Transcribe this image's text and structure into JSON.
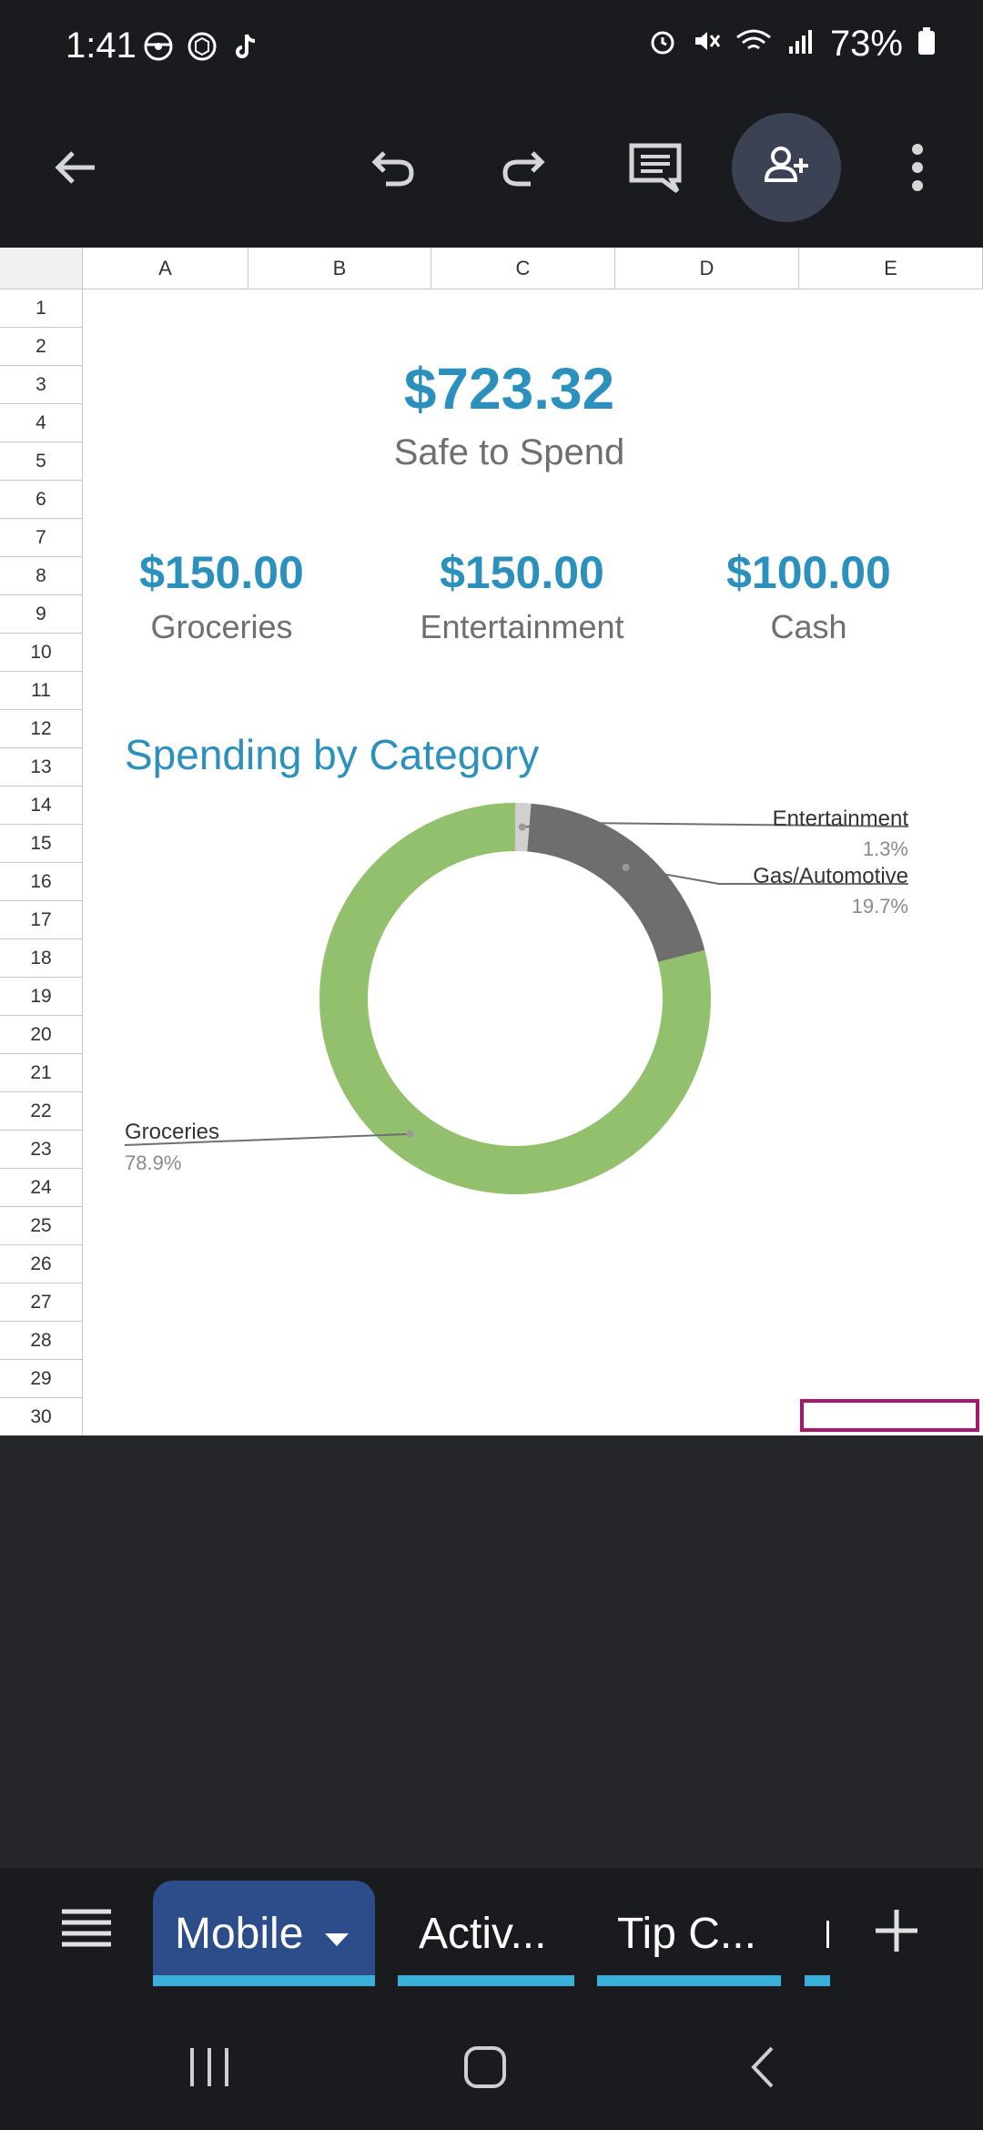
{
  "status_bar": {
    "time": "1:41",
    "battery": "73%"
  },
  "toolbar": {
    "icons": [
      "back-arrow-icon",
      "undo-icon",
      "redo-icon",
      "comment-icon",
      "add-person-icon",
      "more-vert-icon"
    ]
  },
  "columns": [
    "A",
    "B",
    "C",
    "D",
    "E"
  ],
  "rows": [
    "1",
    "2",
    "3",
    "4",
    "5",
    "6",
    "7",
    "8",
    "9",
    "10",
    "11",
    "12",
    "13",
    "14",
    "15",
    "16",
    "17",
    "18",
    "19",
    "20",
    "21",
    "22",
    "23",
    "24",
    "25",
    "26",
    "27",
    "28",
    "29",
    "30"
  ],
  "summary": {
    "amount": "$723.32",
    "label": "Safe to Spend"
  },
  "categories": [
    {
      "amount": "$150.00",
      "label": "Groceries"
    },
    {
      "amount": "$150.00",
      "label": "Entertainment"
    },
    {
      "amount": "$100.00",
      "label": "Cash"
    }
  ],
  "chart_data": {
    "type": "pie",
    "title": "Spending by Category",
    "donut": true,
    "slices": [
      {
        "name": "Entertainment",
        "value": 1.3,
        "label": "1.3%",
        "color": "#d0d0d0"
      },
      {
        "name": "Gas/Automotive",
        "value": 19.7,
        "label": "19.7%",
        "color": "#6e6e6e"
      },
      {
        "name": "Groceries",
        "value": 78.9,
        "label": "78.9%",
        "color": "#92c06c"
      }
    ]
  },
  "tabs": [
    {
      "label": "Mobile",
      "active": true
    },
    {
      "label": "Activ..."
    },
    {
      "label": "Tip C..."
    }
  ],
  "colors": {
    "accent": "#2b91bc",
    "tab_active_bg": "#2d4d8a",
    "tab_underline": "#3aafd9",
    "selection": "#a8166e"
  }
}
